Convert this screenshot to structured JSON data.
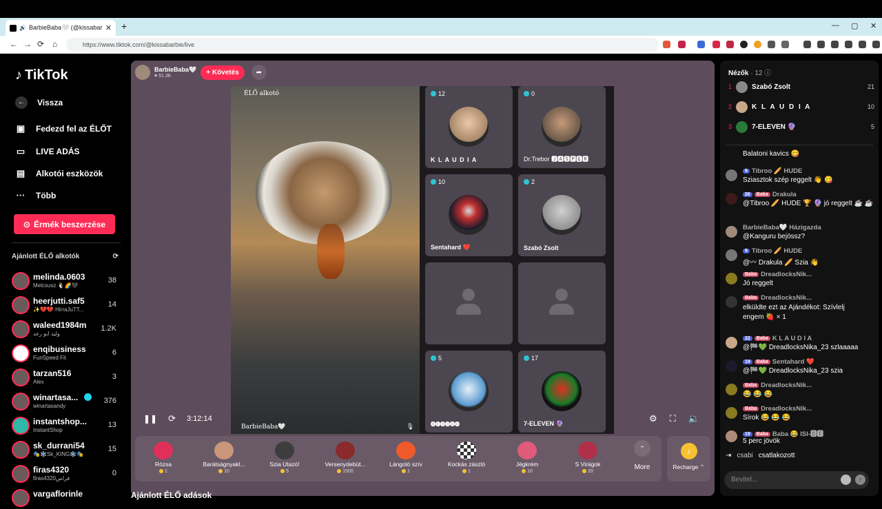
{
  "browser": {
    "tab_title": "BarbieBaba🤍 (@kissabarbie",
    "tab_close": "✕",
    "new_tab": "+",
    "url": "https://www.tiktok.com/@kissabarbie/live",
    "window_controls": [
      "—",
      "▢",
      "✕"
    ]
  },
  "sidebar": {
    "logo": "TikTok",
    "back": "Vissza",
    "menu": [
      {
        "icon": "explore-icon",
        "glyph": "▣",
        "label": "Fedezd fel az ÉLŐT"
      },
      {
        "icon": "live-icon",
        "glyph": "▭",
        "label": "LIVE ADÁS"
      },
      {
        "icon": "creator-tools-icon",
        "glyph": "▤",
        "label": "Alkotói eszközök"
      },
      {
        "icon": "more-icon",
        "glyph": "···",
        "label": "Több"
      }
    ],
    "coins_button": "Érmék beszerzése",
    "recommended_heading": "Ajánlott ÉLŐ alkotók",
    "creators": [
      {
        "name": "melinda.0603",
        "sub": "Melcsusz 🐧🌈🖤",
        "viewers": "38"
      },
      {
        "name": "heerjutti.saf5",
        "sub": "✨💔💔 HirraJuTT...",
        "viewers": "14"
      },
      {
        "name": "waleed1984m",
        "sub": "وليد ابو رعد",
        "viewers": "1.2K"
      },
      {
        "name": "enqibusiness",
        "sub": "FunSpeed Fit",
        "viewers": "6"
      },
      {
        "name": "tarzan516",
        "sub": "Alex",
        "viewers": "3"
      },
      {
        "name": "winartasa...",
        "sub": "winartasandy",
        "viewers": "376"
      },
      {
        "name": "instantshop...",
        "sub": "InstantShop",
        "viewers": "13"
      },
      {
        "name": "sk_durrani54",
        "sub": "🎭❄️Sk_KING❄️🎭",
        "viewers": "15"
      },
      {
        "name": "firas4320",
        "sub": "firas4320فراس",
        "viewers": "0"
      },
      {
        "name": "vargaflorinle",
        "sub": "",
        "viewers": ""
      }
    ]
  },
  "stream": {
    "host_name": "BarbieBaba🤍",
    "host_likes": "♥ 51.3K",
    "follow": "+ Követés",
    "host_label": "ÉLŐ alkotó",
    "host_tag": "BarbieBaba🤍",
    "time": "3:12:14",
    "guests": [
      {
        "count": "12",
        "name": "K L A U D I A",
        "color": "#d8b89a"
      },
      {
        "count": "0",
        "name": "Dr.Trebor 🅹🅰🆂🅿🅴🆁",
        "color": "#7a6a5a"
      },
      {
        "count": "10",
        "name": "Sentahard ❤️",
        "color": "#2a2a3a"
      },
      {
        "count": "2",
        "name": "Szabó Zsolt",
        "color": "#bdbdbd"
      },
      {
        "count": "",
        "name": "",
        "color": ""
      },
      {
        "count": "",
        "name": "",
        "color": ""
      },
      {
        "count": "5",
        "name": "🅑🅔🅝🅓🅞🅝",
        "color": "#3b7fb8"
      },
      {
        "count": "17",
        "name": "7-ELEVEN 🔮",
        "color": "#1f3a20"
      }
    ]
  },
  "gifts": [
    {
      "name": "Rózsa",
      "price": "1",
      "color": "#e0305a"
    },
    {
      "name": "Barátságnyakl...",
      "price": "10",
      "color": "#c9967a"
    },
    {
      "name": "Szia Utazó!",
      "price": "5",
      "color": "#3d3d3d"
    },
    {
      "name": "Versenydebüt...",
      "price": "1500",
      "color": "#8a2a2a"
    },
    {
      "name": "Lángoló szív",
      "price": "1",
      "color": "#f05a2a"
    },
    {
      "name": "Kockás zászló",
      "price": "1",
      "color": "#dddddd"
    },
    {
      "name": "Jégkrém",
      "price": "10",
      "color": "#e05a7a"
    },
    {
      "name": "S Virágok",
      "price": "20",
      "color": "#b0304a"
    }
  ],
  "more_label": "More",
  "recharge_label": "Recharge ⌃",
  "bottom_heading": "Ajánlott ÉLŐ adások",
  "chat": {
    "viewers_title": "Nézők",
    "viewers_count": "· 12 ⓘ",
    "top_viewers": [
      {
        "rank": "1",
        "name": "Szabó Zsolt",
        "score": "21"
      },
      {
        "rank": "2",
        "name": "K L A U D I A",
        "score": "10"
      },
      {
        "rank": "3",
        "name": "7-ELEVEN 🔮",
        "score": "5"
      }
    ],
    "messages": [
      {
        "user": "",
        "text": "Balatoni kavics 😋"
      },
      {
        "user": "Tibroo 🥖 HUDE",
        "text": "Sziasztok szép reggelt 👋 😋"
      },
      {
        "user": "Drakula",
        "text": "@Tibroo 🥖 HUDE 🏆 🔮 jó reggelt ☕ ☕"
      },
      {
        "user": "BarbieBaba🤍 Házigazda",
        "text": "@Kanguru bejössz?"
      },
      {
        "user": "Tibroo 🥖 HUDE",
        "text": "@〰 Drakula 🥖 Szia 👋"
      },
      {
        "user": "DreadlocksNik...",
        "text": "Jó reggelt"
      },
      {
        "user": "DreadlocksNik...",
        "text": "elküldte ezt az Ajándékot: Szívlelj engem 🍓 × 1"
      },
      {
        "user": "K L A U D I A",
        "text": "@🏁💚 DreadlocksNika_23 szlaaaaa"
      },
      {
        "user": "Sentahard ❤️",
        "text": "@🏁💚 DreadlocksNika_23 szia"
      },
      {
        "user": "DreadlocksNik...",
        "text": "😂 😂 😂"
      },
      {
        "user": "DreadlocksNik...",
        "text": "Sírok 😂 😂 😂"
      },
      {
        "user": "Baba 😂 ISI-🅱🅴",
        "text": "5 perc jövök"
      }
    ],
    "joined_user": "csabi",
    "joined_text": "csatlakozott",
    "input_placeholder": "Bevitel..."
  }
}
